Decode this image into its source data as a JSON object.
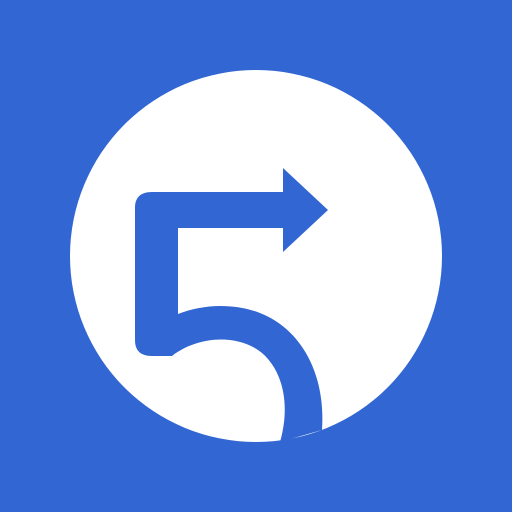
{
  "icon": {
    "name": "five-arrow-logo",
    "description_glyph": "5",
    "colors": {
      "background": "#3267D3",
      "circle": "#FFFFFF",
      "glyph": "#3267D3"
    }
  }
}
